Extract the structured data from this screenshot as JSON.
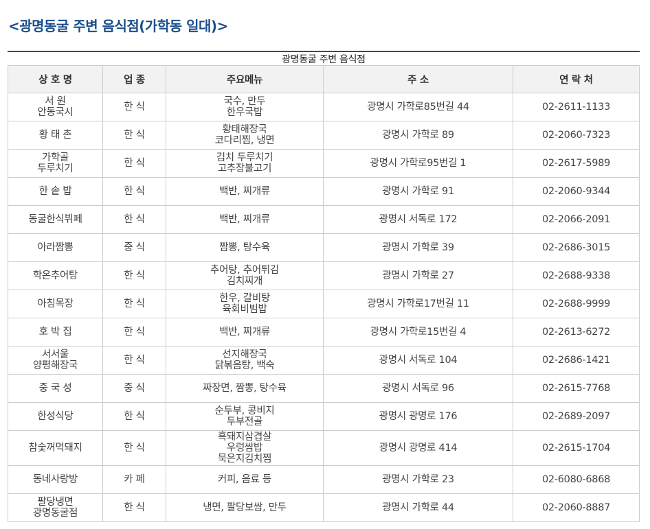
{
  "page": {
    "title": "<광명동굴 주변 음식점(가학동 일대)>"
  },
  "table": {
    "caption": "광명동굴 주변 음식점",
    "headers": [
      "상 호 명",
      "업 종",
      "주요메뉴",
      "주 소",
      "연 락 처"
    ],
    "rows": [
      {
        "name": [
          "서 원",
          "안동국시"
        ],
        "category": "한 식",
        "menu": [
          "국수, 만두",
          "한우국밥"
        ],
        "address": "광명시 가학로85번길 44",
        "phone": "02-2611-1133"
      },
      {
        "name": [
          "황 태 촌"
        ],
        "category": "한 식",
        "menu": [
          "황태해장국",
          "코다리찜, 냉면"
        ],
        "address": "광명시 가학로 89",
        "phone": "02-2060-7323"
      },
      {
        "name": [
          "가학골",
          "두루치기"
        ],
        "category": "한 식",
        "menu": [
          "김치 두루치기",
          "고추장불고기"
        ],
        "address": "광명시 가학로95번길 1",
        "phone": "02-2617-5989"
      },
      {
        "name": [
          "한 솥 밥"
        ],
        "category": "한 식",
        "menu": [
          "백반, 찌개류"
        ],
        "address": "광명시 가학로 91",
        "phone": "02-2060-9344"
      },
      {
        "name": [
          "동굴한식뷔페"
        ],
        "category": "한 식",
        "menu": [
          "백반, 찌개류"
        ],
        "address": "광명시 서독로 172",
        "phone": "02-2066-2091"
      },
      {
        "name": [
          "아라짬뽕"
        ],
        "category": "중 식",
        "menu": [
          "짬뽕, 탕수육"
        ],
        "address": "광명시 가학로 39",
        "phone": "02-2686-3015"
      },
      {
        "name": [
          "학온추어탕"
        ],
        "category": "한 식",
        "menu": [
          "추어탕, 추어튀김",
          "김치찌개"
        ],
        "address": "광명시 가학로 27",
        "phone": "02-2688-9338"
      },
      {
        "name": [
          "아침목장"
        ],
        "category": "한 식",
        "menu": [
          "한우, 갈비탕",
          "육회비빔밥"
        ],
        "address": "광명시 가학로17번길 11",
        "phone": "02-2688-9999"
      },
      {
        "name": [
          "호 박 집"
        ],
        "category": "한 식",
        "menu": [
          "백반, 찌개류"
        ],
        "address": "광명시 가학로15번길 4",
        "phone": "02-2613-6272"
      },
      {
        "name": [
          "서서울",
          "양평해장국"
        ],
        "category": "한 식",
        "menu": [
          "선지해장국",
          "닭볶음탕, 백숙"
        ],
        "address": "광명시 서독로 104",
        "phone": "02-2686-1421"
      },
      {
        "name": [
          "중 국 성"
        ],
        "category": "중 식",
        "menu": [
          "짜장면, 짬뽕, 탕수육"
        ],
        "address": "광명시 서독로 96",
        "phone": "02-2615-7768"
      },
      {
        "name": [
          "한성식당"
        ],
        "category": "한 식",
        "menu": [
          "순두부, 콩비지",
          "두부전골"
        ],
        "address": "광명시 광명로 176",
        "phone": "02-2689-2097"
      },
      {
        "name": [
          "참숯꺼먹돼지"
        ],
        "category": "한 식",
        "menu": [
          "흑돼지삼겹살",
          "우렁쌈밥",
          "묵은지김치찜"
        ],
        "address": "광명시 광명로 414",
        "phone": "02-2615-1704"
      },
      {
        "name": [
          "동네사랑방"
        ],
        "category": "카 페",
        "menu": [
          "커피, 음료 등"
        ],
        "address": "광명시 가학로 23",
        "phone": "02-6080-6868"
      },
      {
        "name": [
          "팔당냉면",
          "광명동굴점"
        ],
        "category": "한 식",
        "menu": [
          "냉면, 팔당보쌈, 만두"
        ],
        "address": "광명시 가학로 44",
        "phone": "02-2060-8887"
      }
    ]
  }
}
